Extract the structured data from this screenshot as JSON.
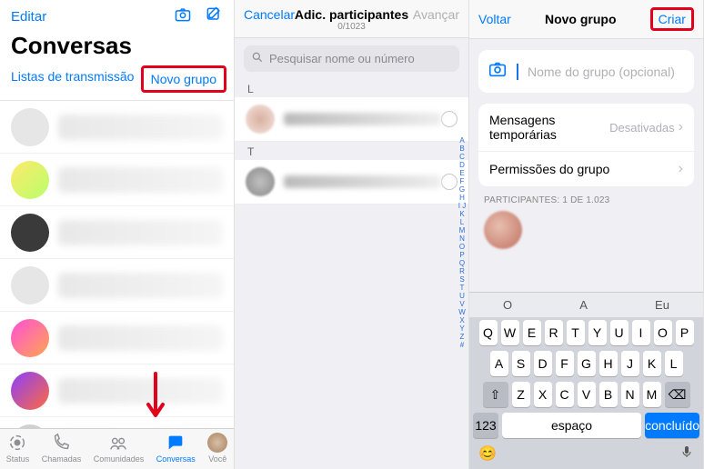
{
  "panel1": {
    "edit": "Editar",
    "title": "Conversas",
    "broadcast": "Listas de transmissão",
    "new_group": "Novo grupo",
    "chats": [
      {
        "avatar": "#e6e6e6"
      },
      {
        "avatar": "linear-gradient(135deg,#ffe96b,#b8ff6b)"
      },
      {
        "avatar": "#3a3a3a"
      },
      {
        "avatar": "#e6e6e6"
      },
      {
        "avatar": "linear-gradient(135deg,#ff4fd8,#ffa64f)"
      },
      {
        "avatar": "linear-gradient(135deg,#8a3fff,#ff6b3f)"
      },
      {
        "avatar": "#d0d0d0"
      }
    ],
    "tabs": {
      "status": "Status",
      "calls": "Chamadas",
      "communities": "Comunidades",
      "chats": "Conversas",
      "you": "Você"
    }
  },
  "panel2": {
    "cancel": "Cancelar",
    "title": "Adic. participantes",
    "counter": "0/1023",
    "advance": "Avançar",
    "search_placeholder": "Pesquisar nome ou número",
    "sections": [
      "L",
      "T"
    ],
    "index": "ABCDEFGHIJKLMNOPQRSTUVWXYZ#"
  },
  "panel3": {
    "back": "Voltar",
    "title": "Novo grupo",
    "create": "Criar",
    "name_placeholder": "Nome do grupo (opcional)",
    "temp_msgs": "Mensagens temporárias",
    "temp_val": "Desativadas",
    "perms": "Permissões do grupo",
    "participants_label": "PARTICIPANTES: 1 DE 1.023",
    "suggestions": [
      "O",
      "A",
      "Eu"
    ],
    "rows": [
      [
        "Q",
        "W",
        "E",
        "R",
        "T",
        "Y",
        "U",
        "I",
        "O",
        "P"
      ],
      [
        "A",
        "S",
        "D",
        "F",
        "G",
        "H",
        "J",
        "K",
        "L"
      ],
      [
        "Z",
        "X",
        "C",
        "V",
        "B",
        "N",
        "M"
      ]
    ],
    "num_key": "123",
    "space": "espaço",
    "done": "concluído"
  }
}
